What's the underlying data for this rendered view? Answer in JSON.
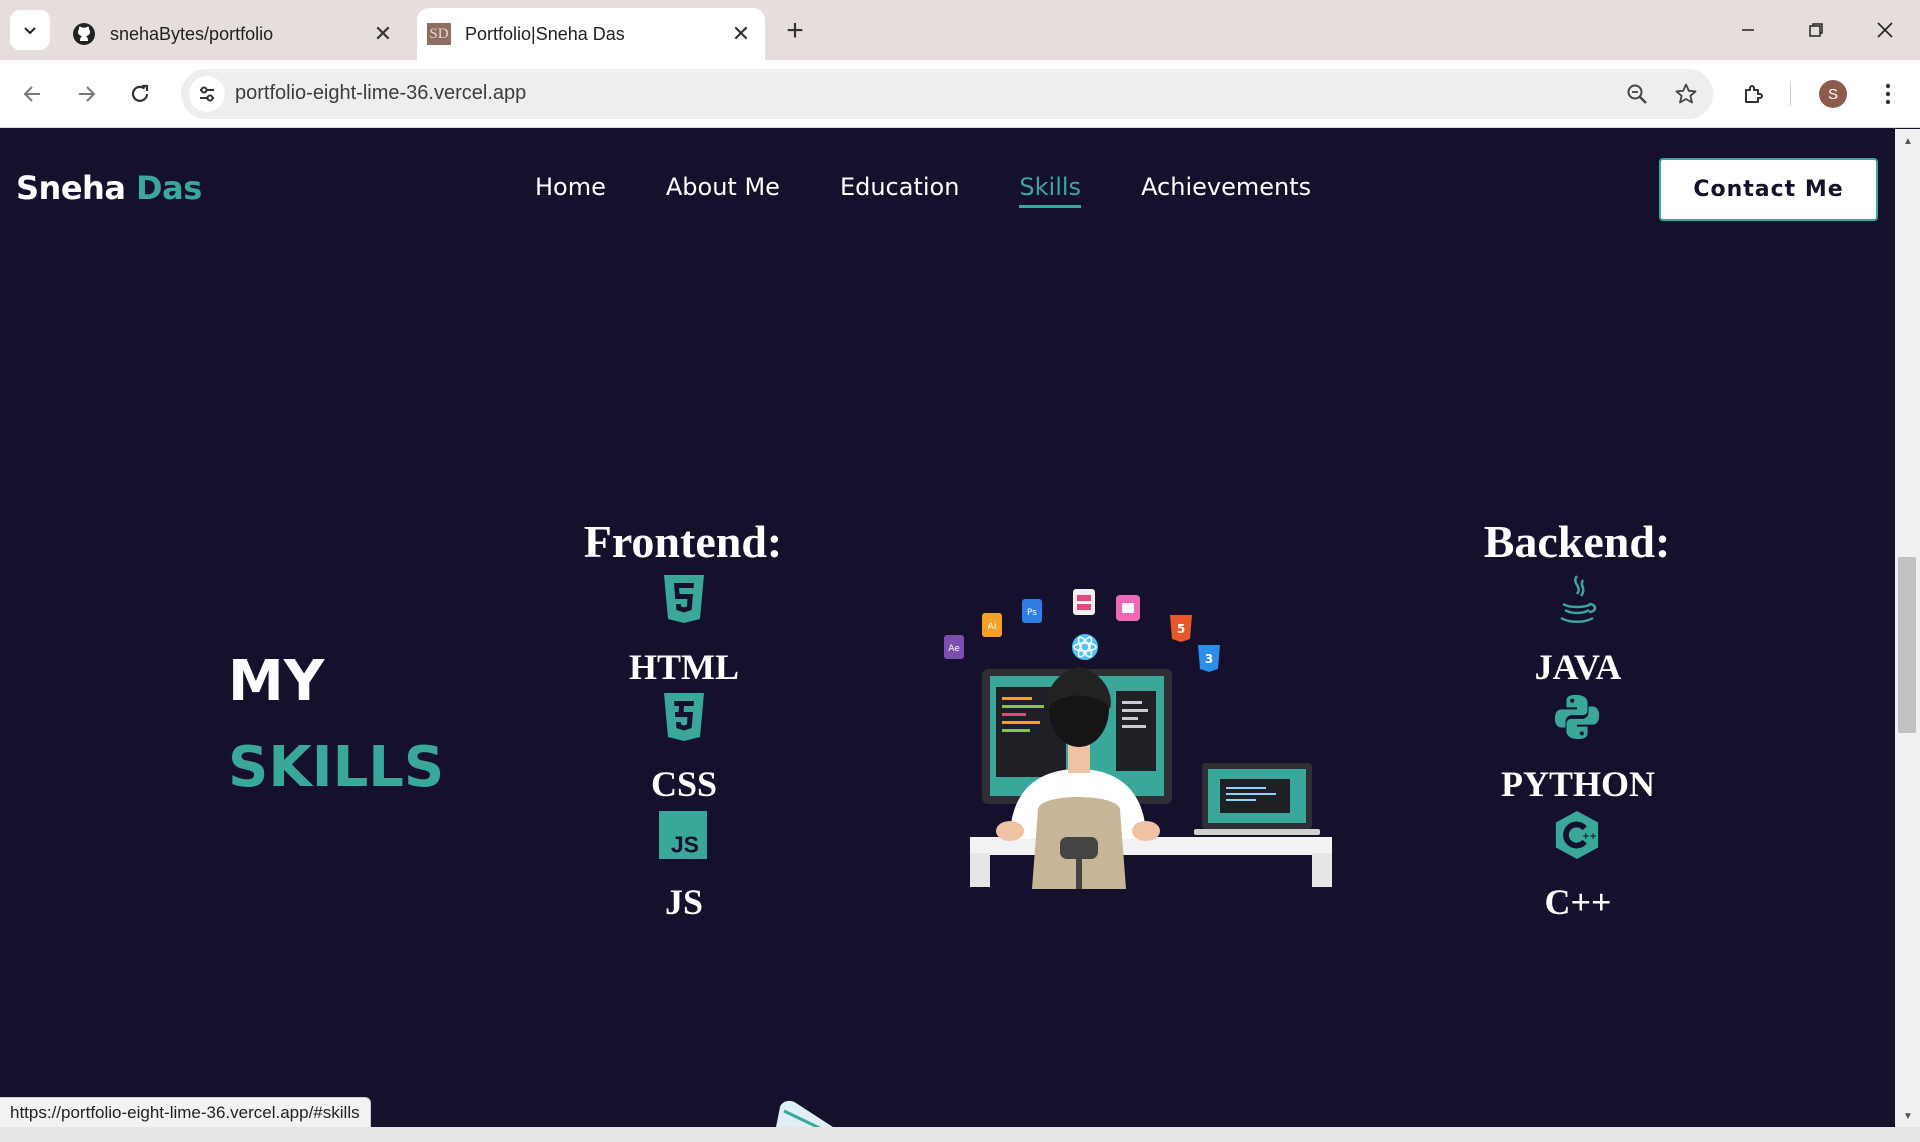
{
  "browser": {
    "tabs": [
      {
        "title": "snehaBytes/portfolio",
        "icon": "github-icon",
        "active": false
      },
      {
        "title": "Portfolio|Sneha Das",
        "icon": "sd-favicon",
        "favicon_text": "SD",
        "active": true
      }
    ],
    "url": "portfolio-eight-lime-36.vercel.app",
    "profile_initial": "S",
    "status_url": "https://portfolio-eight-lime-36.vercel.app/#skills"
  },
  "site": {
    "brand_first": "Sneha",
    "brand_last": "Das",
    "nav": [
      {
        "label": "Home",
        "active": false
      },
      {
        "label": "About Me",
        "active": false
      },
      {
        "label": "Education",
        "active": false
      },
      {
        "label": "Skills",
        "active": true
      },
      {
        "label": "Achievements",
        "active": false
      }
    ],
    "contact_label": "Contact Me"
  },
  "skills": {
    "heading_line1": "MY",
    "heading_line2": "SKILLS",
    "frontend": {
      "title": "Frontend:",
      "items": [
        {
          "label": "HTML",
          "icon": "html5-icon"
        },
        {
          "label": "CSS",
          "icon": "css3-icon"
        },
        {
          "label": "JS",
          "icon": "javascript-icon"
        }
      ]
    },
    "backend": {
      "title": "Backend:",
      "items": [
        {
          "label": "JAVA",
          "icon": "java-icon"
        },
        {
          "label": "PYTHON",
          "icon": "python-icon"
        },
        {
          "label": "C++",
          "icon": "cplusplus-icon"
        }
      ]
    }
  },
  "colors": {
    "page_background": "#15102b",
    "accent": "#3aa79b",
    "text": "#ffffff"
  }
}
